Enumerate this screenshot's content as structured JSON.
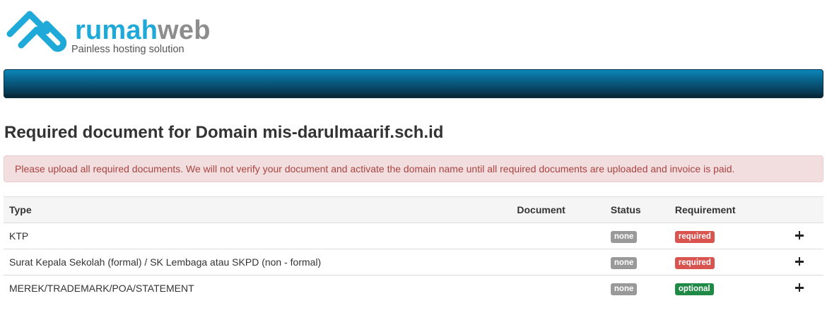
{
  "brand": {
    "name_part1": "rumah",
    "name_part2": "web",
    "tagline": "Painless hosting solution",
    "primary_color": "#1fa9d8",
    "secondary_color": "#8d8d8d"
  },
  "navbar": {
    "color": "#085f86"
  },
  "page": {
    "title": "Required document for Domain mis-darulmaarif.sch.id"
  },
  "alert": {
    "text": "Please upload all required documents. We will not verify your document and activate the domain name until all required documents are uploaded and invoice is paid."
  },
  "table": {
    "headers": {
      "type": "Type",
      "document": "Document",
      "status": "Status",
      "requirement": "Requirement"
    },
    "rows": [
      {
        "type": "KTP",
        "document": "",
        "status": "none",
        "requirement": "required",
        "action_icon": "plus-icon"
      },
      {
        "type": "Surat Kepala Sekolah (formal) / SK Lembaga atau SKPD (non - formal)",
        "document": "",
        "status": "none",
        "requirement": "required",
        "action_icon": "plus-icon"
      },
      {
        "type": "MEREK/TRADEMARK/POA/STATEMENT",
        "document": "",
        "status": "none",
        "requirement": "optional",
        "action_icon": "plus-icon"
      }
    ]
  }
}
